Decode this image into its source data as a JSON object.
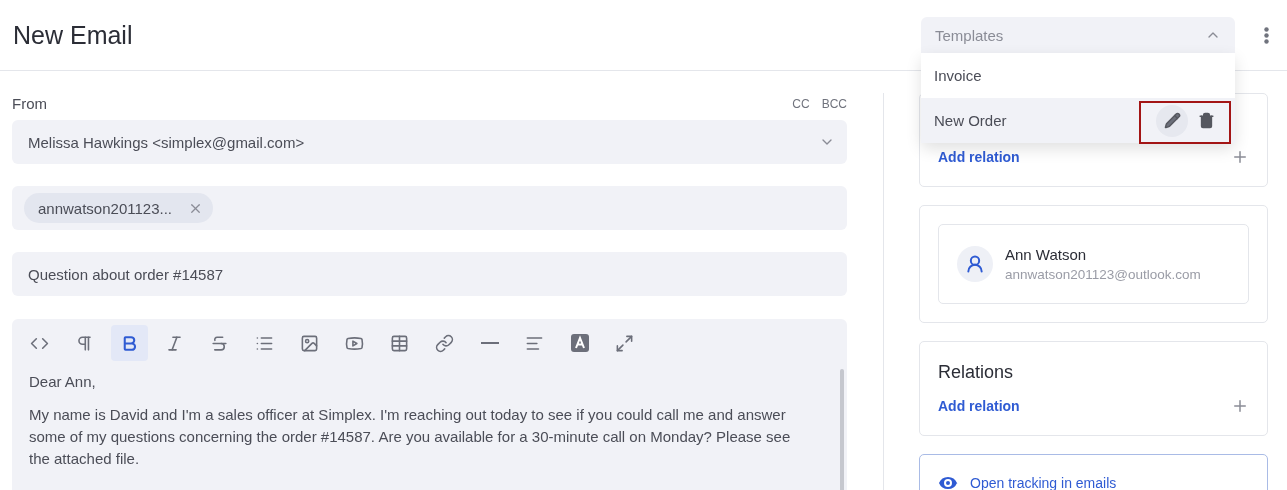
{
  "header": {
    "title": "New Email"
  },
  "templates": {
    "placeholder": "Templates",
    "expanded": true,
    "items": [
      {
        "label": "Invoice",
        "selected": false
      },
      {
        "label": "New Order",
        "selected": true
      }
    ]
  },
  "from": {
    "label": "From",
    "cc": "CC",
    "bcc": "BCC",
    "value": "Melissa Hawkings <simplex@gmail.com>"
  },
  "recipients": [
    {
      "label": "annwatson201123..."
    }
  ],
  "subject": {
    "value": "Question about order #14587"
  },
  "toolbar": [
    {
      "kind": "code",
      "selected": false
    },
    {
      "kind": "paragraph",
      "selected": false
    },
    {
      "kind": "bold",
      "selected": true
    },
    {
      "kind": "italic",
      "selected": false
    },
    {
      "kind": "strike",
      "selected": false
    },
    {
      "kind": "list",
      "selected": false
    },
    {
      "kind": "image",
      "selected": false
    },
    {
      "kind": "video",
      "selected": false
    },
    {
      "kind": "table",
      "selected": false
    },
    {
      "kind": "link",
      "selected": false
    },
    {
      "kind": "rule",
      "selected": false
    },
    {
      "kind": "align",
      "selected": false
    },
    {
      "kind": "textcolor",
      "selected": false
    },
    {
      "kind": "fullscreen",
      "selected": false
    }
  ],
  "body": [
    "Dear Ann,",
    "My name is David and I'm a sales officer at Simplex. I'm reaching out today to see if you could call me and answer some of my questions concerning the order #14587. Are you available for a 30-minute call on Monday? Please see the attached file."
  ],
  "sidebar": {
    "first_card": {
      "action": "Add relation"
    },
    "contact": {
      "name": "Ann Watson",
      "email": "annwatson201123@outlook.com"
    },
    "relations": {
      "title": "Relations",
      "action": "Add relation"
    },
    "tracking": {
      "label": "Open tracking in emails"
    }
  }
}
